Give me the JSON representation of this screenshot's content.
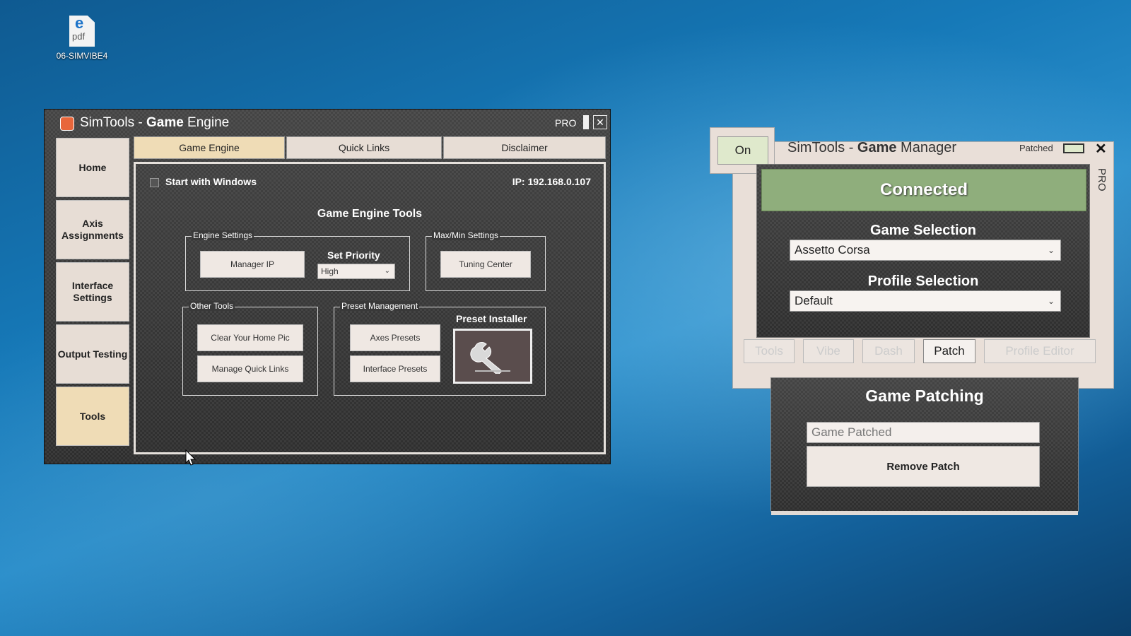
{
  "desktop": {
    "icon_label": "06-SIMVIBE4",
    "icon_glyph": "e",
    "icon_ext": "pdf"
  },
  "engine": {
    "title_prefix": "SimTools - ",
    "title_bold": "Game",
    "title_suffix": " Engine",
    "pro_label": "PRO",
    "close_glyph": "✕",
    "sidebar": [
      {
        "label": "Home"
      },
      {
        "label": "Axis Assignments"
      },
      {
        "label": "Interface Settings"
      },
      {
        "label": "Output Testing"
      },
      {
        "label": "Tools",
        "active": true
      }
    ],
    "tabs": [
      {
        "label": "Game Engine",
        "active": true
      },
      {
        "label": "Quick Links"
      },
      {
        "label": "Disclaimer"
      }
    ],
    "start_with_windows": "Start with Windows",
    "ip": "IP: 192.168.0.107",
    "tools_title": "Game Engine Tools",
    "engine_settings": {
      "legend": "Engine Settings",
      "manager_ip": "Manager IP",
      "set_priority": "Set Priority",
      "priority_value": "High"
    },
    "maxmin": {
      "legend": "Max/Min Settings",
      "tuning_center": "Tuning Center"
    },
    "other_tools": {
      "legend": "Other Tools",
      "clear_home_pic": "Clear Your Home Pic",
      "manage_quick_links": "Manage Quick Links"
    },
    "preset_management": {
      "legend": "Preset Management",
      "axes_presets": "Axes Presets",
      "interface_presets": "Interface Presets",
      "preset_installer": "Preset Installer"
    }
  },
  "manager": {
    "on_label": "On",
    "title_prefix": "SimTools - ",
    "title_bold": "Game",
    "title_suffix": " Manager",
    "patched_label": "Patched",
    "close_glyph": "✕",
    "pro_label": "PRO",
    "status": "Connected",
    "game_selection_label": "Game Selection",
    "game_value": "Assetto Corsa",
    "profile_selection_label": "Profile Selection",
    "profile_value": "Default",
    "tabs": [
      {
        "label": "Tools"
      },
      {
        "label": "Vibe"
      },
      {
        "label": "Dash"
      },
      {
        "label": "Patch",
        "active": true
      },
      {
        "label": "Profile Editor"
      }
    ],
    "patching_title": "Game Patching",
    "patch_status": "Game Patched",
    "remove_patch": "Remove Patch"
  }
}
